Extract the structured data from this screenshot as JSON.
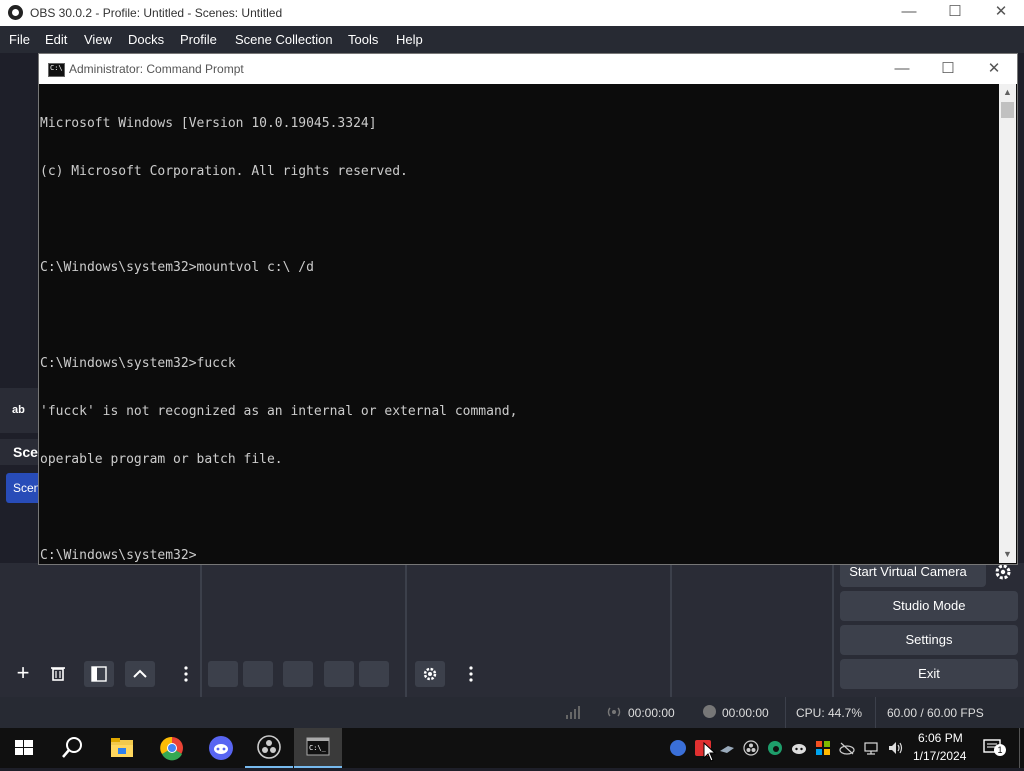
{
  "obs": {
    "title": "OBS 30.0.2 - Profile: Untitled - Scenes: Untitled",
    "menu": [
      "File",
      "Edit",
      "View",
      "Docks",
      "Profile",
      "Scene Collection",
      "Tools",
      "Help"
    ],
    "sources_label": "ab",
    "scenes_header": "Scen",
    "scene_item": "Scen",
    "controls": {
      "virtual_camera": "Start Virtual Camera",
      "studio_mode": "Studio Mode",
      "settings": "Settings",
      "exit": "Exit"
    },
    "status": {
      "stream_time": "00:00:00",
      "record_time": "00:00:00",
      "cpu": "CPU: 44.7%",
      "fps": "60.00 / 60.00 FPS"
    }
  },
  "cmd": {
    "title": "Administrator: Command Prompt",
    "lines": [
      "Microsoft Windows [Version 10.0.19045.3324]",
      "(c) Microsoft Corporation. All rights reserved.",
      "",
      "C:\\Windows\\system32>mountvol c:\\ /d",
      "",
      "C:\\Windows\\system32>fucck",
      "'fucck' is not recognized as an internal or external command,",
      "operable program or batch file.",
      "",
      "C:\\Windows\\system32>"
    ]
  },
  "taskbar": {
    "time": "6:06 PM",
    "date": "1/17/2024",
    "notification_count": "1"
  }
}
